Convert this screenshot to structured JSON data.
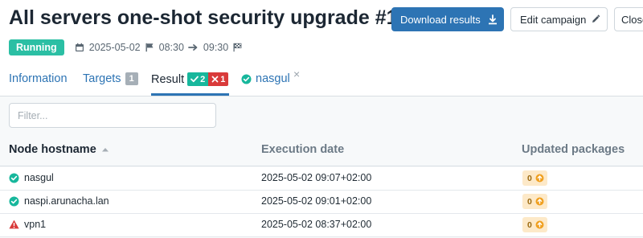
{
  "header": {
    "title": "All servers one-shot security upgrade #1",
    "download_label": "Download results",
    "edit_label": "Edit campaign",
    "close_label": "Close"
  },
  "status": {
    "state": "Running",
    "date": "2025-05-02",
    "start_time": "08:30",
    "end_time": "09:30"
  },
  "tabs": {
    "information": "Information",
    "targets": "Targets",
    "targets_count": "1",
    "result": "Result",
    "result_success": "2",
    "result_errors": "1",
    "node": "nasgul",
    "close_symbol": "×"
  },
  "filter": {
    "placeholder": "Filter..."
  },
  "table": {
    "columns": {
      "host": "Node hostname",
      "date": "Execution date",
      "packages": "Updated packages"
    },
    "rows": [
      {
        "status": "success",
        "host": "nasgul",
        "date": "2025-05-02 09:07+02:00",
        "packages": "0"
      },
      {
        "status": "success",
        "host": "naspi.arunacha.lan",
        "date": "2025-05-02 09:01+02:00",
        "packages": "0"
      },
      {
        "status": "error",
        "host": "vpn1",
        "date": "2025-05-02 08:37+02:00",
        "packages": "0"
      }
    ]
  },
  "colors": {
    "primary": "#2d74b4",
    "success": "#17b79c",
    "error": "#d93a3a",
    "running": "#2bbfa4",
    "warning_bg": "#fde9c8",
    "warning": "#f0a020"
  }
}
